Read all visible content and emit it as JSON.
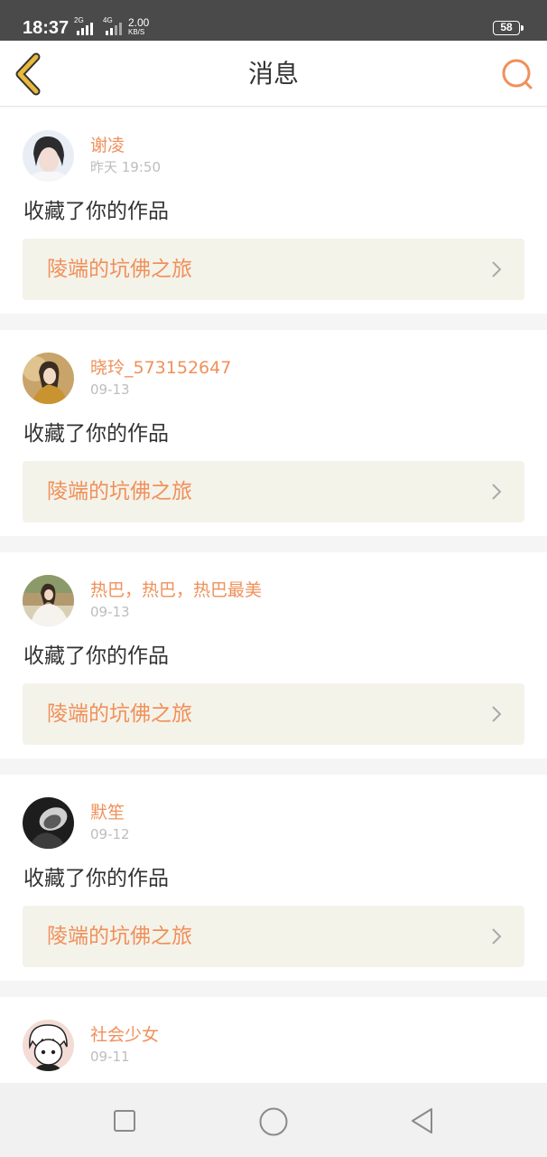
{
  "status_bar": {
    "time": "18:37",
    "signal_1_label": "2G",
    "signal_2_label": "4G",
    "speed_value": "2.00",
    "speed_unit": "KB/S",
    "battery": "58"
  },
  "header": {
    "title": "消息",
    "back_icon": "chevron-left-icon",
    "search_icon": "search-icon"
  },
  "messages": [
    {
      "username": "谢凌",
      "time": "昨天 19:50",
      "action": "收藏了你的作品",
      "work_title": "陵端的坑佛之旅"
    },
    {
      "username": "晓玲_573152647",
      "time": "09-13",
      "action": "收藏了你的作品",
      "work_title": "陵端的坑佛之旅"
    },
    {
      "username": "热巴，热巴，热巴最美",
      "time": "09-13",
      "action": "收藏了你的作品",
      "work_title": "陵端的坑佛之旅"
    },
    {
      "username": "默笙",
      "time": "09-12",
      "action": "收藏了你的作品",
      "work_title": "陵端的坑佛之旅"
    },
    {
      "username": "社会少女",
      "time": "09-11"
    }
  ],
  "colors": {
    "accent": "#f0905a",
    "back_icon": "#e8b93a",
    "link_bg": "#f4f3ea"
  }
}
